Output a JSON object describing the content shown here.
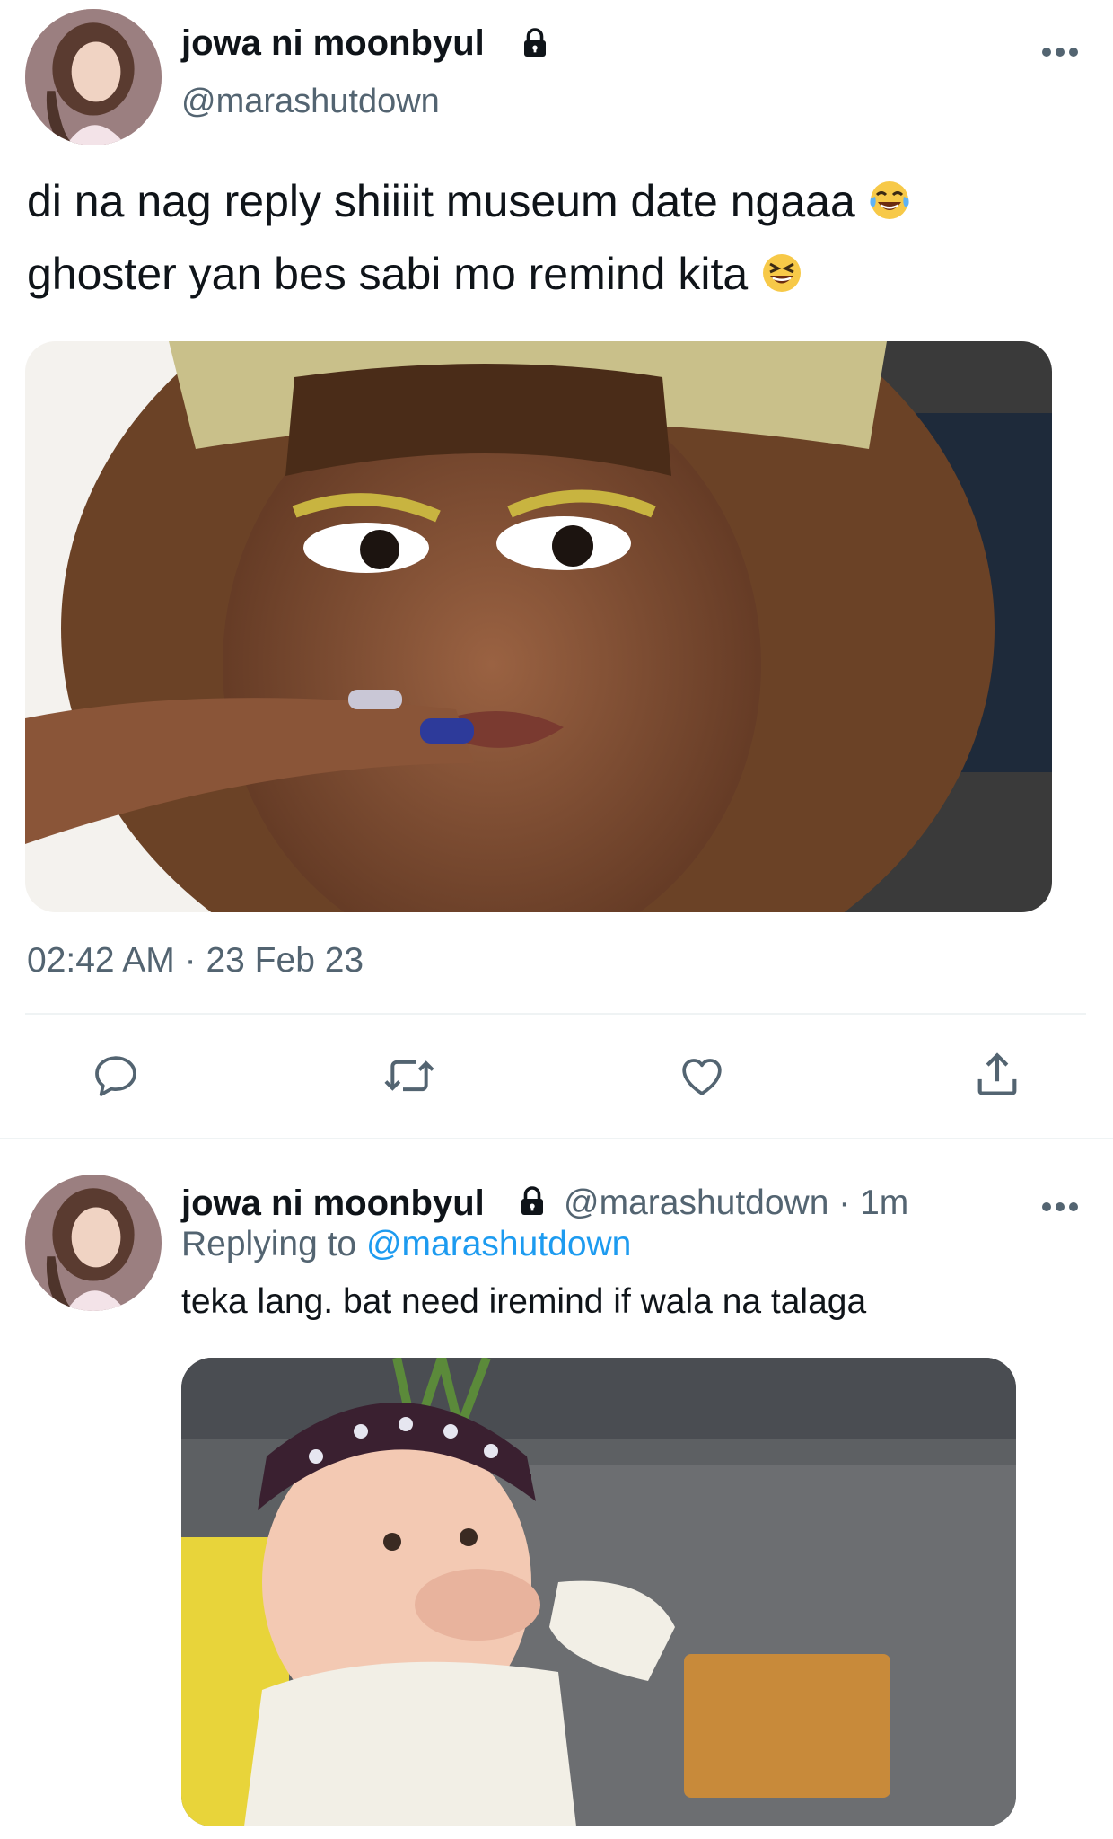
{
  "tweet": {
    "display_name": "jowa ni moonbyul",
    "handle": "@marashutdown",
    "text_line1": "di na nag reply shiiiit museum date ngaaa",
    "text_line2": "ghoster yan bes sabi mo remind kita",
    "emoji_line1": "face-with-tears-of-joy",
    "emoji_line2": "grinning-squinting-face",
    "time": "02:42 AM",
    "separator": "·",
    "date": "23 Feb 23",
    "media_alt_icon": "reaction-gif-image",
    "actions": [
      "reply-icon",
      "retweet-icon",
      "like-icon",
      "share-icon"
    ]
  },
  "reply": {
    "display_name": "jowa ni moonbyul",
    "handle": "@marashutdown",
    "separator": "·",
    "age": "1m",
    "replying_prefix": "Replying to",
    "replying_to": "@marashutdown",
    "text": "teka lang. bat need iremind if wala na talaga",
    "media_alt_icon": "reaction-gif-image"
  },
  "colors": {
    "text_primary": "#0f1419",
    "text_secondary": "#536471",
    "link": "#1d9bf0",
    "divider": "#eff3f4"
  }
}
